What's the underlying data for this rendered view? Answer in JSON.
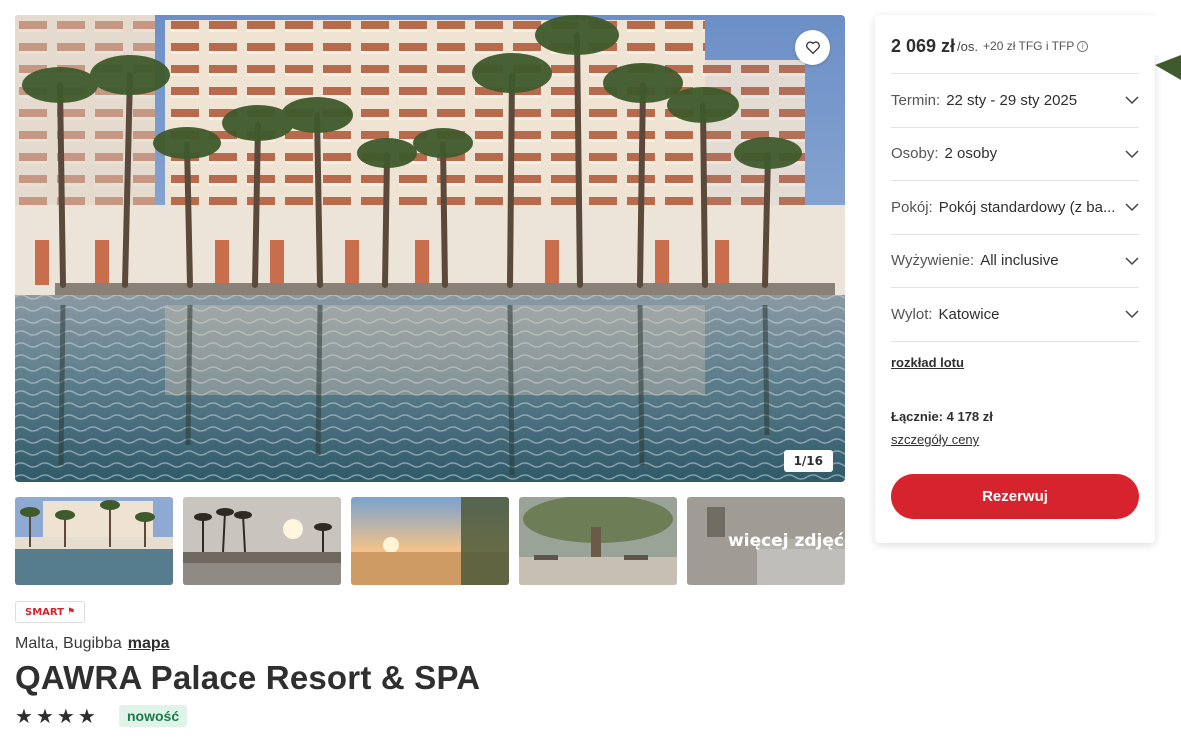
{
  "gallery": {
    "counter": "1/16",
    "more_photos_label": "więcej zdjęć",
    "favorite_icon": "heart-outline-icon",
    "thumbnails": [
      "pool-hotel",
      "sunset-palms",
      "sunset-coast",
      "restaurant-tree",
      "hotel-room"
    ]
  },
  "hotel": {
    "badge": "SMART",
    "badge_icon": "flag-icon",
    "location": "Malta, Bugibba",
    "map_link": "mapa",
    "name": "QAWRA Palace Resort & SPA",
    "stars": 4,
    "new_badge": "nowość"
  },
  "booking": {
    "price": "2 069 zł",
    "price_per": "/os.",
    "price_extra": "+20 zł TFG i TFP",
    "options": [
      {
        "label": "Termin:",
        "value": "22 sty - 29 sty 2025"
      },
      {
        "label": "Osoby:",
        "value": "2 osoby"
      },
      {
        "label": "Pokój:",
        "value": "Pokój standardowy (z ba..."
      },
      {
        "label": "Wyżywienie:",
        "value": "All inclusive"
      },
      {
        "label": "Wylot:",
        "value": "Katowice"
      }
    ],
    "flight_schedule_link": "rozkład lotu",
    "total": "Łącznie: 4 178 zł",
    "price_details_link": "szczegóły ceny",
    "book_button": "Rezerwuj"
  },
  "colors": {
    "accent": "#d7232d",
    "new_badge_bg": "#dff3e9",
    "new_badge_text": "#1d7a4c",
    "text": "#2f2f2f"
  }
}
